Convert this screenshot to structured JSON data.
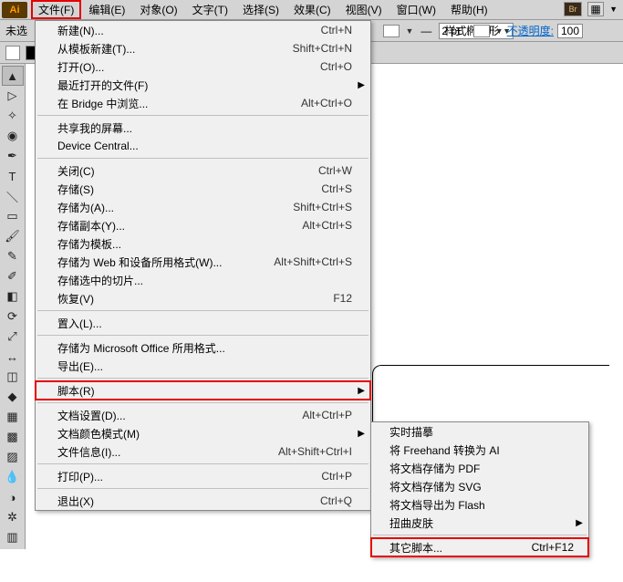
{
  "app_icon": "Ai",
  "menubar": {
    "items": [
      {
        "label": "文件(F)",
        "open": true
      },
      {
        "label": "编辑(E)"
      },
      {
        "label": "对象(O)"
      },
      {
        "label": "文字(T)"
      },
      {
        "label": "选择(S)"
      },
      {
        "label": "效果(C)"
      },
      {
        "label": "视图(V)"
      },
      {
        "label": "窗口(W)"
      },
      {
        "label": "帮助(H)"
      }
    ],
    "br_label": "Br"
  },
  "toolbar": {
    "unselected_label": "未选",
    "stroke_label": "2 pt. 椭圆形",
    "style_label": "样式:",
    "opacity_label": "不透明度:",
    "opacity_value": "100"
  },
  "file_menu": [
    {
      "label": "新建(N)...",
      "shortcut": "Ctrl+N"
    },
    {
      "label": "从模板新建(T)...",
      "shortcut": "Shift+Ctrl+N"
    },
    {
      "label": "打开(O)...",
      "shortcut": "Ctrl+O"
    },
    {
      "label": "最近打开的文件(F)",
      "submenu": true
    },
    {
      "label": "在 Bridge 中浏览...",
      "shortcut": "Alt+Ctrl+O"
    },
    {
      "sep": true
    },
    {
      "label": "共享我的屏幕..."
    },
    {
      "label": "Device Central..."
    },
    {
      "sep": true
    },
    {
      "label": "关闭(C)",
      "shortcut": "Ctrl+W"
    },
    {
      "label": "存储(S)",
      "shortcut": "Ctrl+S"
    },
    {
      "label": "存储为(A)...",
      "shortcut": "Shift+Ctrl+S"
    },
    {
      "label": "存储副本(Y)...",
      "shortcut": "Alt+Ctrl+S"
    },
    {
      "label": "存储为模板..."
    },
    {
      "label": "存储为 Web 和设备所用格式(W)...",
      "shortcut": "Alt+Shift+Ctrl+S"
    },
    {
      "label": "存储选中的切片..."
    },
    {
      "label": "恢复(V)",
      "shortcut": "F12"
    },
    {
      "sep": true
    },
    {
      "label": "置入(L)..."
    },
    {
      "sep": true
    },
    {
      "label": "存储为 Microsoft Office 所用格式..."
    },
    {
      "label": "导出(E)..."
    },
    {
      "sep": true
    },
    {
      "label": "脚本(R)",
      "submenu": true,
      "highlight": true
    },
    {
      "sep": true
    },
    {
      "label": "文档设置(D)...",
      "shortcut": "Alt+Ctrl+P"
    },
    {
      "label": "文档颜色模式(M)",
      "submenu": true
    },
    {
      "label": "文件信息(I)...",
      "shortcut": "Alt+Shift+Ctrl+I"
    },
    {
      "sep": true
    },
    {
      "label": "打印(P)...",
      "shortcut": "Ctrl+P"
    },
    {
      "sep": true
    },
    {
      "label": "退出(X)",
      "shortcut": "Ctrl+Q"
    }
  ],
  "script_submenu": [
    {
      "label": "实时描摹"
    },
    {
      "label": "将 Freehand 转换为 AI"
    },
    {
      "label": "将文档存储为 PDF"
    },
    {
      "label": "将文档存储为 SVG"
    },
    {
      "label": "将文档导出为 Flash"
    },
    {
      "label": "扭曲皮肤",
      "submenu": true
    },
    {
      "sep": true
    },
    {
      "label": "其它脚本...",
      "shortcut": "Ctrl+F12",
      "highlight": true
    }
  ]
}
